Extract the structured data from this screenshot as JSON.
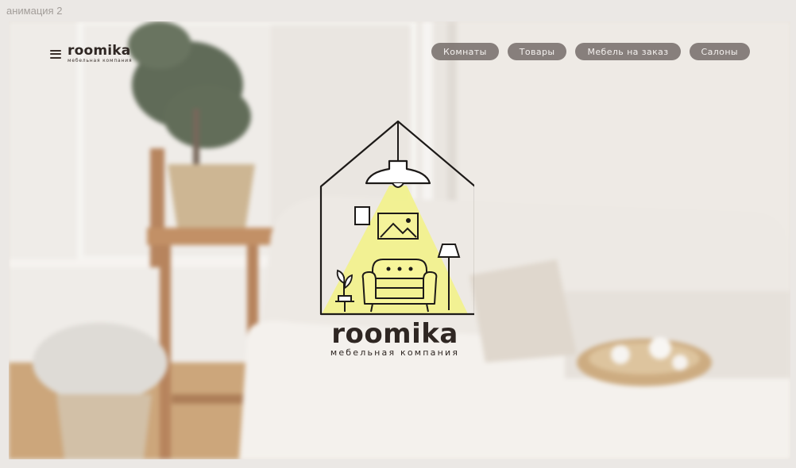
{
  "frame": {
    "label": "анимация 2"
  },
  "header": {
    "brand_name": "roomika",
    "brand_tagline": "мебельная компания"
  },
  "nav": {
    "items": [
      {
        "label": "Комнаты"
      },
      {
        "label": "Товары"
      },
      {
        "label": "Мебель на заказ"
      },
      {
        "label": "Салоны"
      }
    ]
  },
  "hero_logo": {
    "name": "roomika",
    "tagline": "мебельная компания"
  },
  "colors": {
    "page_background": "#ebe8e5",
    "pill_background": "#766e6a",
    "pill_text": "#f4f1ef",
    "brand_text": "#2f2723",
    "light_beam": "#f2f28a"
  },
  "icons": [
    "menu-icon",
    "house-logo-icon"
  ]
}
